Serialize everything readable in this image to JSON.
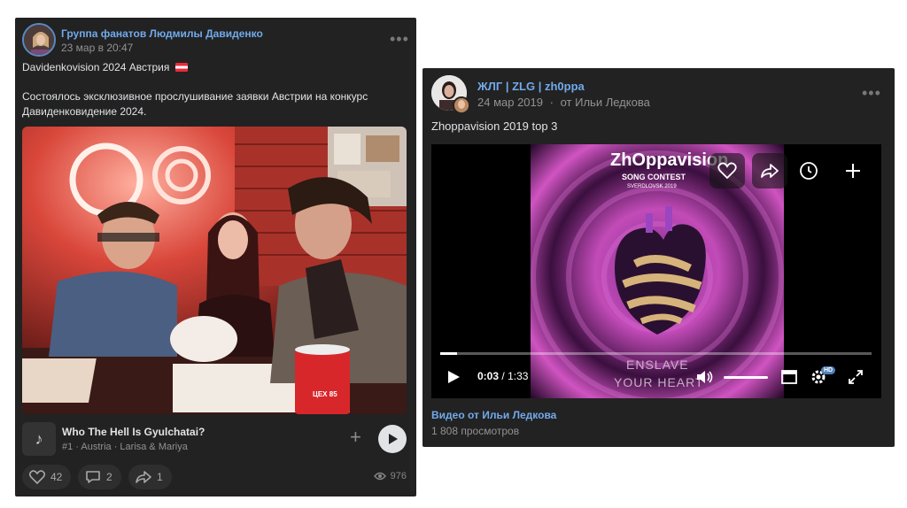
{
  "post1": {
    "author": "Группа фанатов Людмилы Давиденко",
    "date": "23 мар в 20:47",
    "title_line": "Davidenkovision 2024 Австрия",
    "body_line1": "Состоялось эксклюзивное прослушивание заявки Австрии на конкурс",
    "body_line2": "Давиденковидение 2024.",
    "more_icon": "more-horizontal-icon",
    "photo_cup_text": "ЦЕХ 85",
    "audio": {
      "title": "Who The Hell Is Gyulchatai?",
      "subtitle": "#1 · Austria · Larisa & Mariya"
    },
    "actions": {
      "likes": "42",
      "comments": "2",
      "shares": "1",
      "views": "976"
    }
  },
  "post2": {
    "author": "ЖЛГ | ZLG | zh0ppa",
    "date": "24 мар 2019",
    "from_label": "от Ильи Ледкова",
    "text": "Zhoppavision 2019 top 3",
    "poster": {
      "logo": "ZhOppavision",
      "subtitle": "SONG CONTEST",
      "city": "SVERDLOVSK 2019",
      "caption_top": "ENSLAVE",
      "caption_bottom": "YOUR HEART"
    },
    "player": {
      "current_time": "0:03",
      "separator": "/",
      "duration": "1:33",
      "progress_fraction": 0.04,
      "hd_badge": "HD"
    },
    "video_link": "Видео от Ильи Ледкова",
    "views": "1 808 просмотров"
  }
}
